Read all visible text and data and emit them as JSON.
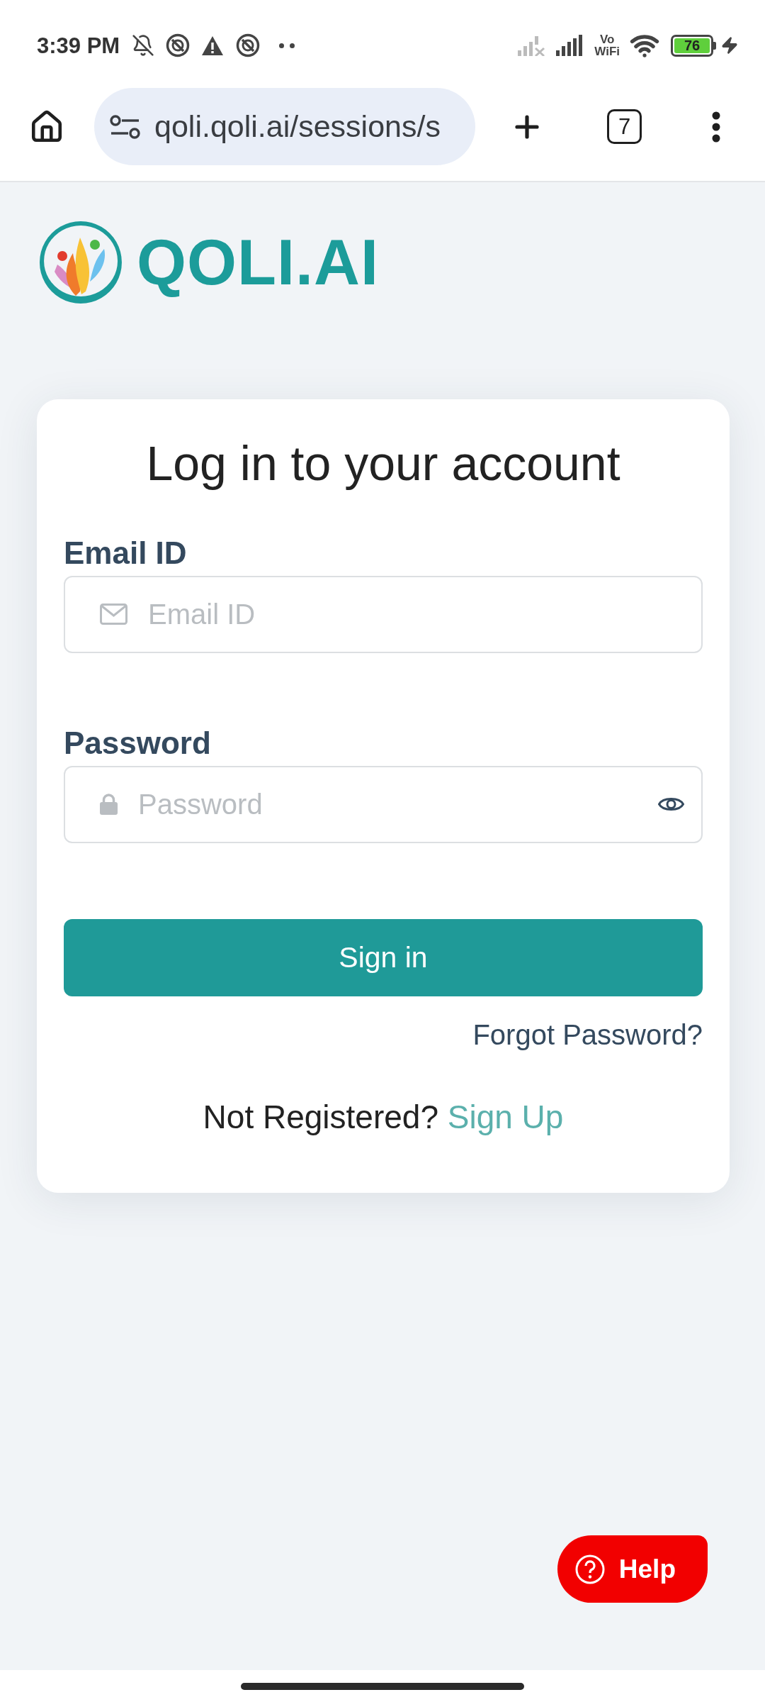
{
  "status_bar": {
    "time": "3:39 PM",
    "network_label": [
      "Vo",
      "WiFi"
    ],
    "battery": "76"
  },
  "browser": {
    "url": "qoli.qoli.ai/sessions/s",
    "tab_count": "7"
  },
  "logo": {
    "text": "QOLI.AI"
  },
  "login_card": {
    "title": "Log in to your account",
    "fields": [
      {
        "kind": "email",
        "label": "Email ID",
        "placeholder": "Email ID"
      },
      {
        "kind": "password",
        "label": "Password",
        "placeholder": "Password"
      }
    ],
    "submit": "Sign in",
    "forgot_link": "Forgot Password?",
    "register_prompt": "Not Registered?",
    "register_link": "Sign Up"
  },
  "help_button": {
    "label": "Help"
  }
}
